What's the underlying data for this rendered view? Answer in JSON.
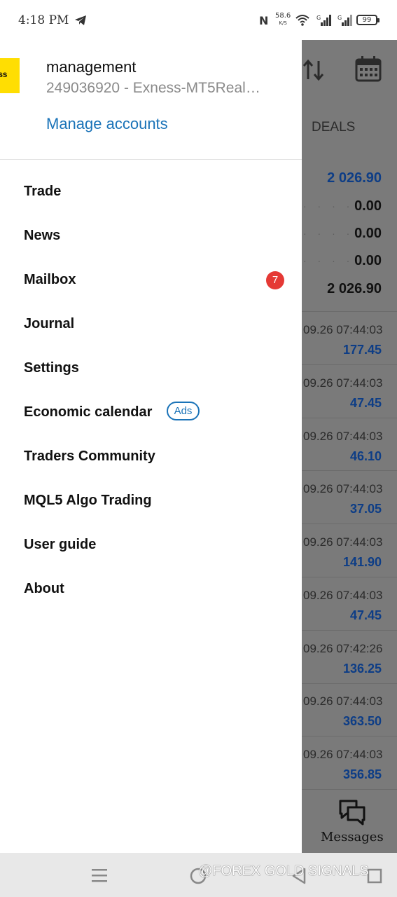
{
  "status_bar": {
    "time": "4:18 PM",
    "net_speed_value": "58.6",
    "net_speed_unit": "K/S",
    "battery": "99",
    "icons": [
      "telegram-icon",
      "nfc-icon",
      "wifi-icon",
      "signal-icon",
      "signal-icon",
      "battery-icon"
    ]
  },
  "account": {
    "logo_text": "ness",
    "name": "management",
    "server": "249036920 - Exness-MT5Real…",
    "manage_label": "Manage accounts"
  },
  "menu": [
    {
      "label": "Trade"
    },
    {
      "label": "News"
    },
    {
      "label": "Mailbox",
      "badge": "7"
    },
    {
      "label": "Journal"
    },
    {
      "label": "Settings"
    },
    {
      "label": "Economic calendar",
      "tag": "Ads"
    },
    {
      "label": "Traders Community"
    },
    {
      "label": "MQL5 Algo Trading"
    },
    {
      "label": "User guide"
    },
    {
      "label": "About"
    }
  ],
  "background_app": {
    "tab_label": "DEALS",
    "summary_values": [
      "2 026.90",
      "0.00",
      "0.00",
      "0.00",
      "2 026.90"
    ],
    "deals": [
      {
        "date": "09.26 07:44:03",
        "value": "177.45"
      },
      {
        "date": "09.26 07:44:03",
        "value": "47.45"
      },
      {
        "date": "09.26 07:44:03",
        "value": "46.10"
      },
      {
        "date": "09.26 07:44:03",
        "value": "37.05"
      },
      {
        "date": "09.26 07:44:03",
        "value": "141.90"
      },
      {
        "date": "09.26 07:44:03",
        "value": "47.45"
      },
      {
        "date": "09.26 07:42:26",
        "value": "136.25"
      },
      {
        "date": "09.26 07:44:03",
        "value": "363.50"
      },
      {
        "date": "09.26 07:44:03",
        "value": "356.85"
      }
    ],
    "messages_label": "Messages"
  },
  "nav_bar": {
    "watermark": "@FOREX GOLD SIGNALS"
  },
  "colors": {
    "accent": "#1a73b8",
    "badge": "#e53935",
    "logo": "#ffde02",
    "overlay": "#7a7a7a",
    "deal_value": "#0d3d86"
  }
}
